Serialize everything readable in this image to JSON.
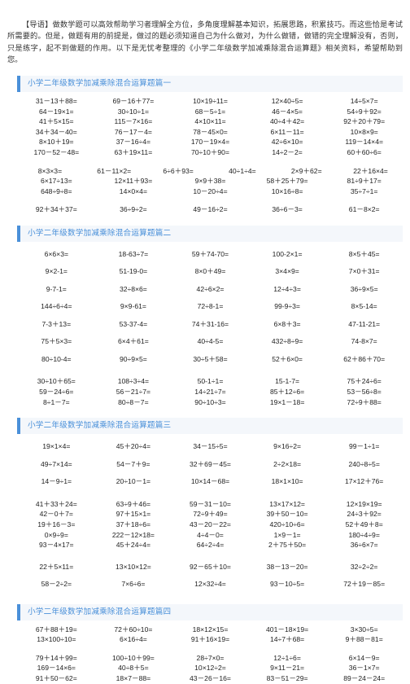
{
  "intro": {
    "text": "【导语】做数学题可以高效帮助学习者理解全方位，多角度理解基本知识，拓展思路，积累技巧。而这些恰是考试所需要的。但是，做题有用的前提是，做过的题必须知道自己为什么做对，为什么做错，做错的完全理解没有，否则，只是练字，起不到做题的作用。以下是无忧考整理的《小学二年级数学加减乘除混合运算题》相关资料，希望帮助到您。"
  },
  "theme": {
    "accent_color": "#4a90d9",
    "header_bg": "#f4f7fb",
    "text_color": "#333333"
  },
  "sections": [
    {
      "title": "小学二年级数学加减乘除混合运算题篇一",
      "density": "dense",
      "groups": [
        {
          "rows": [
            [
              "31－13＋88=",
              "69－16＋77=",
              "10×19÷11=",
              "12×40÷5=",
              "14÷5×7="
            ],
            [
              "64－19×1=",
              "30÷10÷1=",
              "68－5÷1=",
              "46－4×5=",
              "54÷9＋92="
            ],
            [
              "41＋5×15=",
              "115－7×16=",
              "4×10×11=",
              "40÷4＋42=",
              "92＋20＋79="
            ],
            [
              "34＋34－40=",
              "76－17－4=",
              "78－45×0=",
              "6×11－11=",
              "10×8×9="
            ],
            [
              "8×10＋19=",
              "37－16÷4=",
              "170－19×4=",
              "42÷6×10=",
              "119－14×4="
            ],
            [
              "170－52－48=",
              "63＋19×11=",
              "70÷10＋90=",
              "14÷2－2=",
              "60＋60÷6="
            ]
          ]
        },
        {
          "rows": [
            [
              "8×3×3=",
              "61－11×2=",
              "6÷6＋93=",
              "40÷1÷4=",
              "2×9＋62=",
              "22＋16×4="
            ],
            [
              "6×17÷13=",
              "12×11＋93=",
              "9×9＋38=",
              "58＋25＋79=",
              "81÷9＋17="
            ],
            [
              "648÷9÷8=",
              "14×0×4=",
              "10－20÷4=",
              "10×16÷8=",
              "35÷7÷1="
            ]
          ]
        },
        {
          "rows": [
            [
              "92＋34＋37=",
              "36÷9÷2=",
              "49－16÷2=",
              "36÷6－3=",
              "61－8×2="
            ]
          ]
        }
      ]
    },
    {
      "title": "小学二年级数学加减乘除混合运算题篇二",
      "density": "airy",
      "groups": [
        {
          "style": "airy",
          "rows": [
            [
              "6×6×3=",
              "18-63÷7=",
              "59＋74-70=",
              "100-2×1=",
              "8×5＋45="
            ],
            [
              "9×2-1=",
              "51-19-0=",
              "8×0＋49=",
              "3×4×9=",
              "7×0＋31="
            ],
            [
              "9-7-1=",
              "32÷8×6=",
              "42÷6×2=",
              "12÷4÷3=",
              "36÷9×5="
            ],
            [
              "144÷6÷4=",
              "9×9-61=",
              "72÷8-1=",
              "99-9÷3=",
              "8×5-14="
            ],
            [
              "7-3＋13=",
              "53-37-4=",
              "74＋31-16=",
              "6×8＋3=",
              "47-11-21="
            ],
            [
              "75＋5×3=",
              "6×4＋61=",
              "40÷4-5=",
              "432÷8÷9=",
              "74-8×7="
            ],
            [
              "80÷10-4=",
              "90÷9×5=",
              "30÷5＋58=",
              "52＋6×0=",
              "62＋86＋70="
            ]
          ]
        },
        {
          "style": "dense",
          "rows": [
            [
              "30÷10＋65=",
              "108÷3÷4=",
              "50-1÷1=",
              "15-1-7=",
              "75＋24÷6="
            ],
            [
              "59－24÷6=",
              "56－21÷7=",
              "14÷21÷7=",
              "85＋12÷6=",
              "53－56÷8="
            ],
            [
              "8÷1－7=",
              "80÷8－7=",
              "90÷10÷3=",
              "19×1－18=",
              "72÷9＋88="
            ]
          ]
        }
      ]
    },
    {
      "title": "小学二年级数学加减乘除混合运算题篇三",
      "density": "airy",
      "groups": [
        {
          "style": "airy",
          "rows": [
            [
              "19×1×4=",
              "45＋20÷4=",
              "34－15÷5=",
              "9×16÷2=",
              "99－1÷1="
            ],
            [
              "49÷7×14=",
              "54－7＋9=",
              "32＋69－45=",
              "2÷2×18=",
              "240÷8÷5="
            ],
            [
              "14－9÷1=",
              "20÷10－1=",
              "10×14－68=",
              "18×1×10=",
              "17×12＋76="
            ]
          ]
        },
        {
          "style": "dense",
          "rows": [
            [
              "41＋33＋24=",
              "63÷9＋46=",
              "59－31－10=",
              "13×17×12=",
              "12×19×19="
            ],
            [
              "42－0＋7=",
              "97＋15×1=",
              "72÷9＋49=",
              "39＋50－10=",
              "24÷3＋92="
            ],
            [
              "19＋16－3=",
              "37＋18÷6=",
              "43－20－22=",
              "420÷10÷6=",
              "52＋49＋8="
            ],
            [
              "0×9÷9=",
              "222－12×18=",
              "4÷4－0=",
              "1×9－1=",
              "180÷4÷9="
            ],
            [
              "93－4×17=",
              "45＋24÷4=",
              "64÷2÷4=",
              "2＋75＋50=",
              "36÷6×7="
            ]
          ]
        },
        {
          "style": "airy",
          "rows": [
            [
              "22＋5×11=",
              "13×10×12=",
              "92－65＋10=",
              "38－13－20=",
              "32÷2÷2="
            ],
            [
              "58－2÷2=",
              "7×6÷6=",
              "12×32÷4=",
              "93－10÷5=",
              "72＋19－85="
            ]
          ]
        }
      ]
    },
    {
      "title": "小学二年级数学加减乘除混合运算题篇四",
      "density": "dense",
      "groups": [
        {
          "rows": [
            [
              "67＋88＋19=",
              "72＋60÷10=",
              "18×12×15=",
              "401－18×19=",
              "3×30÷5="
            ],
            [
              "13×100÷10=",
              "6×16÷4=",
              "91＋16×19=",
              "14÷7＋68=",
              "9＋88－81="
            ]
          ]
        },
        {
          "rows": [
            [
              "79＋14＋99=",
              "100÷10＋99=",
              "28÷7×0=",
              "12÷1÷6=",
              "6×14－9="
            ],
            [
              "169－14×6=",
              "40÷8＋5=",
              "10×12÷2=",
              "9×11－21=",
              "36－1×7="
            ],
            [
              "91＋50－62=",
              "18×7－88=",
              "43－26－16=",
              "83－51－29=",
              "89－24－24="
            ]
          ]
        }
      ]
    }
  ]
}
